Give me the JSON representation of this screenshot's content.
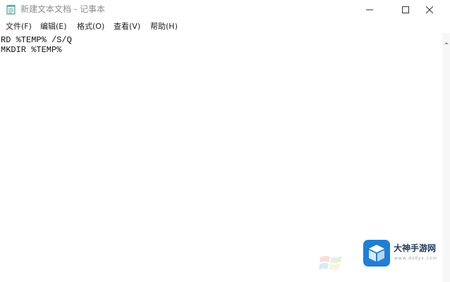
{
  "window": {
    "title": "新建文本文档 - 记事本",
    "app_icon": "notepad-icon",
    "controls": {
      "minimize_icon": "minimize-icon",
      "maximize_icon": "maximize-icon",
      "close_icon": "close-icon"
    }
  },
  "menu": {
    "items": [
      {
        "label": "文件(F)"
      },
      {
        "label": "编辑(E)"
      },
      {
        "label": "格式(O)"
      },
      {
        "label": "查看(V)"
      },
      {
        "label": "帮助(H)"
      }
    ]
  },
  "editor": {
    "lines": [
      "RD %TEMP% /S/Q",
      "MKDIR %TEMP%"
    ]
  },
  "watermark": {
    "title": "大神手游网",
    "url": "www.dsdyx.com",
    "brand_color": "#1e7fd6"
  }
}
